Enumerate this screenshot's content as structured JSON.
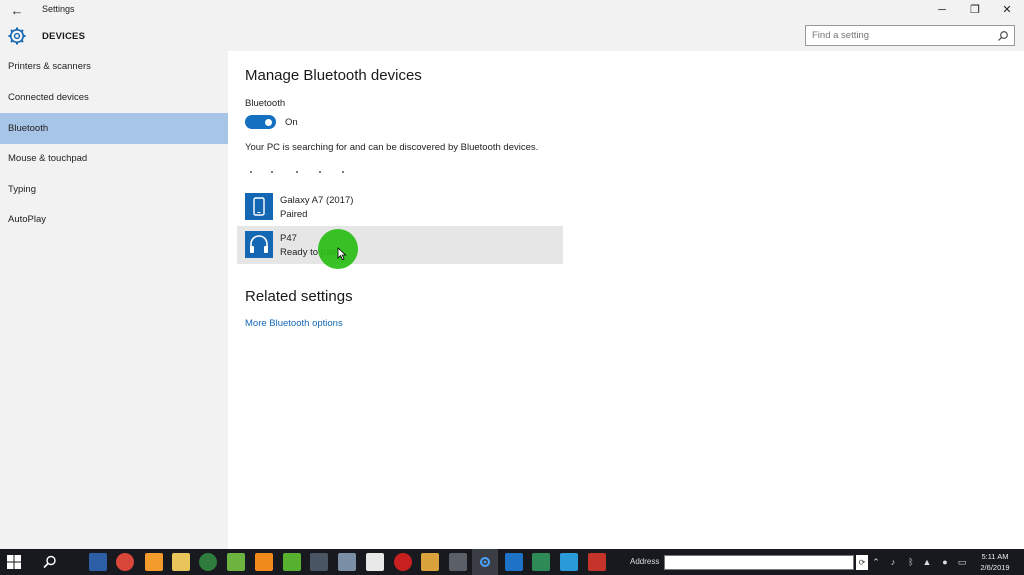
{
  "titlebar": {
    "app_title": "Settings",
    "back_glyph": "←",
    "minimize_glyph": "─",
    "maximize_glyph": "❐",
    "close_glyph": "✕"
  },
  "header": {
    "section_title": "DEVICES",
    "search_placeholder": "Find a setting"
  },
  "sidebar": {
    "items": [
      {
        "label": "Printers & scanners",
        "active": false
      },
      {
        "label": "Connected devices",
        "active": false
      },
      {
        "label": "Bluetooth",
        "active": true
      },
      {
        "label": "Mouse & touchpad",
        "active": false
      },
      {
        "label": "Typing",
        "active": false
      },
      {
        "label": "AutoPlay",
        "active": false
      }
    ]
  },
  "main": {
    "title": "Manage Bluetooth devices",
    "bluetooth_label": "Bluetooth",
    "toggle_state": "On",
    "toggle_on": true,
    "status_text": "Your PC is searching for and can be discovered by Bluetooth devices.",
    "devices": [
      {
        "name": "Galaxy A7 (2017)",
        "status": "Paired",
        "icon": "phone-icon"
      },
      {
        "name": "P47",
        "status": "Ready to pair",
        "icon": "headphones-icon"
      }
    ],
    "related_title": "Related settings",
    "related_link": "More Bluetooth options"
  },
  "taskbar": {
    "address_label": "Address",
    "address_value": "",
    "clock_time": "5:11 AM",
    "clock_date": "2/6/2019"
  },
  "colors": {
    "accent": "#1467b3",
    "sidebar_active": "#a7c5e6",
    "link": "#1468b8",
    "cursor_highlight": "#28be14"
  }
}
